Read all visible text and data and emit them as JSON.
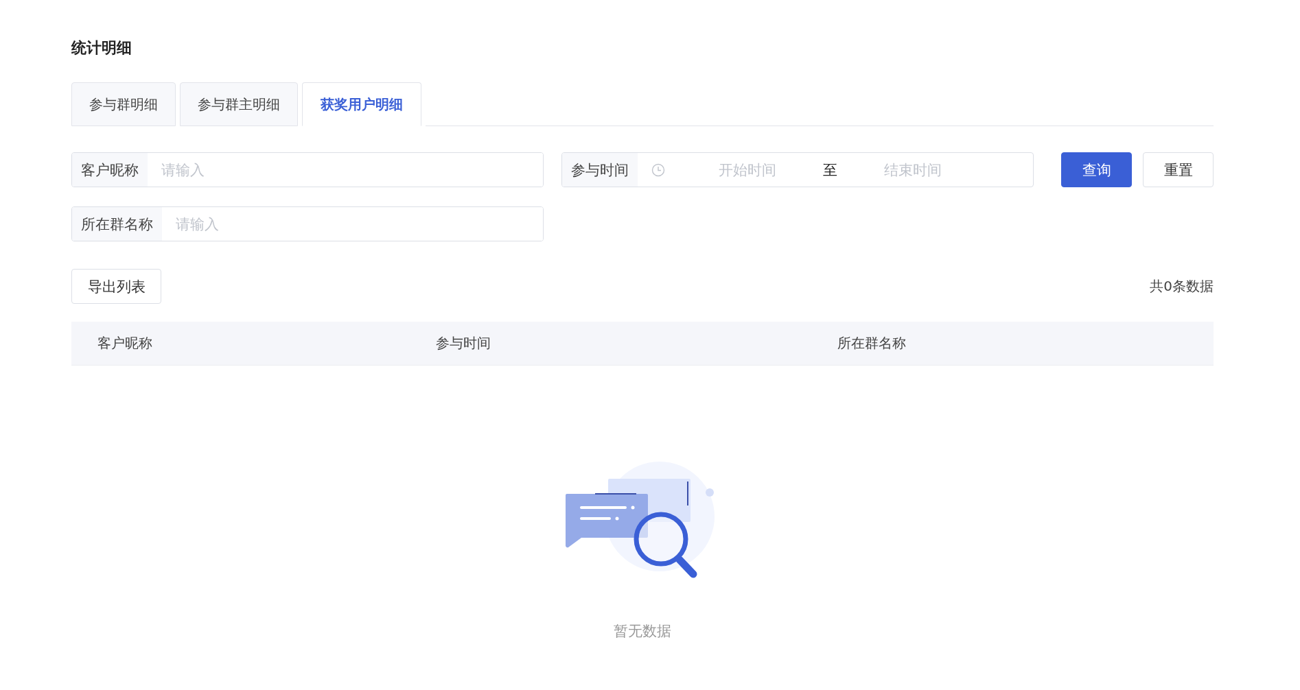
{
  "title": "统计明细",
  "tabs": [
    {
      "label": "参与群明细",
      "selected": false
    },
    {
      "label": "参与群主明细",
      "selected": false
    },
    {
      "label": "获奖用户明细",
      "selected": true
    }
  ],
  "filters": {
    "nickname": {
      "label": "客户昵称",
      "placeholder": "请输入"
    },
    "time_range": {
      "label": "参与时间",
      "start_placeholder": "开始时间",
      "separator": "至",
      "end_placeholder": "结束时间"
    },
    "group_name": {
      "label": "所在群名称",
      "placeholder": "请输入"
    }
  },
  "buttons": [
    {
      "label": "查询",
      "kind": "primary"
    },
    {
      "label": "重置",
      "kind": "default"
    }
  ],
  "export_button": "导出列表",
  "total_count": "共0条数据",
  "table": {
    "columns": [
      "客户昵称",
      "参与时间",
      "所在群名称"
    ]
  },
  "empty_state": {
    "text": "暂无数据"
  }
}
